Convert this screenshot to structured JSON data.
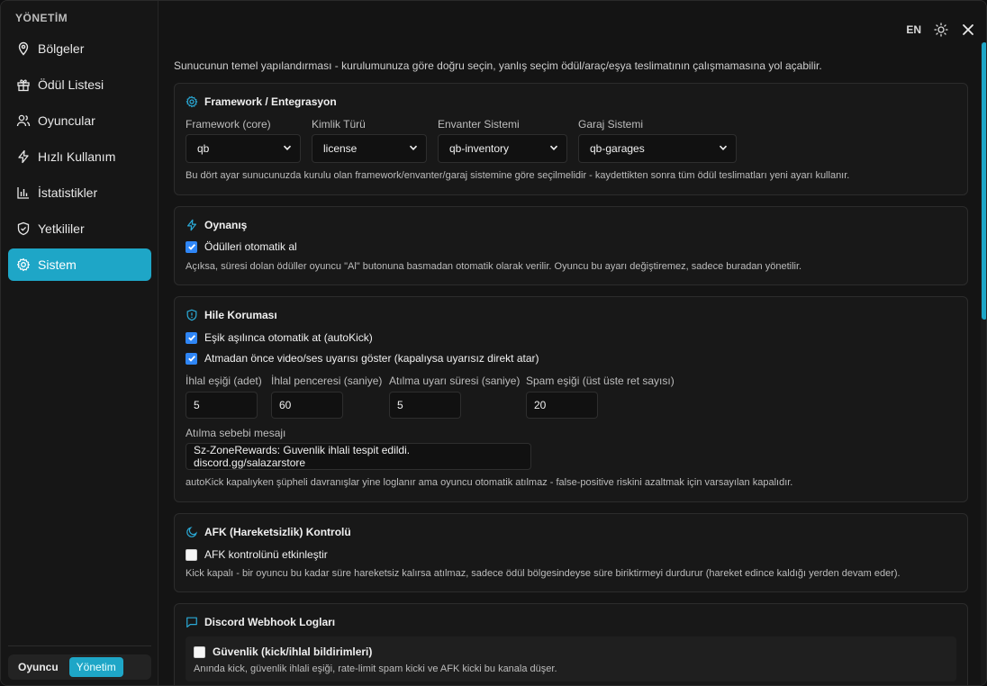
{
  "sidebar": {
    "title": "YÖNETİM",
    "items": [
      {
        "label": "Bölgeler",
        "icon": "map-pin-icon"
      },
      {
        "label": "Ödül Listesi",
        "icon": "gift-icon"
      },
      {
        "label": "Oyuncular",
        "icon": "users-icon"
      },
      {
        "label": "Hızlı Kullanım",
        "icon": "lightning-icon"
      },
      {
        "label": "İstatistikler",
        "icon": "bar-chart-icon"
      },
      {
        "label": "Yetkililer",
        "icon": "shield-icon"
      },
      {
        "label": "Sistem",
        "icon": "gear-icon",
        "active": true
      }
    ],
    "mode": {
      "player_label": "Oyuncu",
      "admin_label": "Yönetim",
      "selected": "Yönetim"
    }
  },
  "topbar": {
    "language": "EN",
    "theme_icon": "sun-icon",
    "close_icon": "close-icon"
  },
  "intro": "Sunucunun temel yapılandırması - kurulumunuza göre doğru seçin, yanlış seçim ödül/araç/eşya teslimatının çalışmamasına yol açabilir.",
  "framework": {
    "title": "Framework / Entegrasyon",
    "icon": "gear-icon",
    "fields": [
      {
        "label": "Framework (core)",
        "value": "qb"
      },
      {
        "label": "Kimlik Türü",
        "value": "license"
      },
      {
        "label": "Envanter Sistemi",
        "value": "qb-inventory"
      },
      {
        "label": "Garaj Sistemi",
        "value": "qb-garages"
      }
    ],
    "help": "Bu dört ayar sunucunuzda kurulu olan framework/envanter/garaj sistemine göre seçilmelidir - kaydettikten sonra tüm ödül teslimatları yeni ayarı kullanır."
  },
  "gameplay": {
    "title": "Oynanış",
    "icon": "lightning-icon",
    "checkbox": {
      "label": "Ödülleri otomatik al",
      "checked": true
    },
    "help": "Açıksa, süresi dolan ödüller oyuncu \"Al\" butonuna basmadan otomatik olarak verilir. Oyuncu bu ayarı değiştiremez, sadece buradan yönetilir."
  },
  "anticheat": {
    "title": "Hile Koruması",
    "icon": "shield-alert-icon",
    "checkboxes": [
      {
        "label": "Eşik aşılınca otomatik at (autoKick)",
        "checked": true
      },
      {
        "label": "Atmadan önce video/ses uyarısı göster (kapalıysa uyarısız direkt atar)",
        "checked": true
      }
    ],
    "fields": [
      {
        "label": "İhlal eşiği (adet)",
        "value": "5"
      },
      {
        "label": "İhlal penceresi (saniye)",
        "value": "60"
      },
      {
        "label": "Atılma uyarı süresi (saniye)",
        "value": "5"
      },
      {
        "label": "Spam eşiği (üst üste ret sayısı)",
        "value": "20"
      }
    ],
    "kick_reason": {
      "label": "Atılma sebebi mesajı",
      "value": "Sz-ZoneRewards: Guvenlik ihlali tespit edildi. discord.gg/salazarstore"
    },
    "help": "autoKick kapalıyken şüpheli davranışlar yine loglanır ama oyuncu otomatik atılmaz - false-positive riskini azaltmak için varsayılan kapalıdır."
  },
  "afk": {
    "title": "AFK (Hareketsizlik) Kontrolü",
    "icon": "moon-icon",
    "checkbox": {
      "label": "AFK kontrolünü etkinleştir",
      "checked": false
    },
    "help": "Kick kapalı - bir oyuncu bu kadar süre hareketsiz kalırsa atılmaz, sadece ödül bölgesindeyse süre biriktirmeyi durdurur (hareket edince kaldığı yerden devam eder)."
  },
  "discord": {
    "title": "Discord Webhook Logları",
    "icon": "chat-icon",
    "items": [
      {
        "label": "Güvenlik (kick/ihlal bildirimleri)",
        "checked": false,
        "desc": "Anında kick, güvenlik ihlali eşiği, rate-limit spam kicki ve AFK kicki bu kanala düşer."
      }
    ]
  },
  "colors": {
    "accent": "#1ea6c7",
    "checkbox": "#2f86f6"
  }
}
